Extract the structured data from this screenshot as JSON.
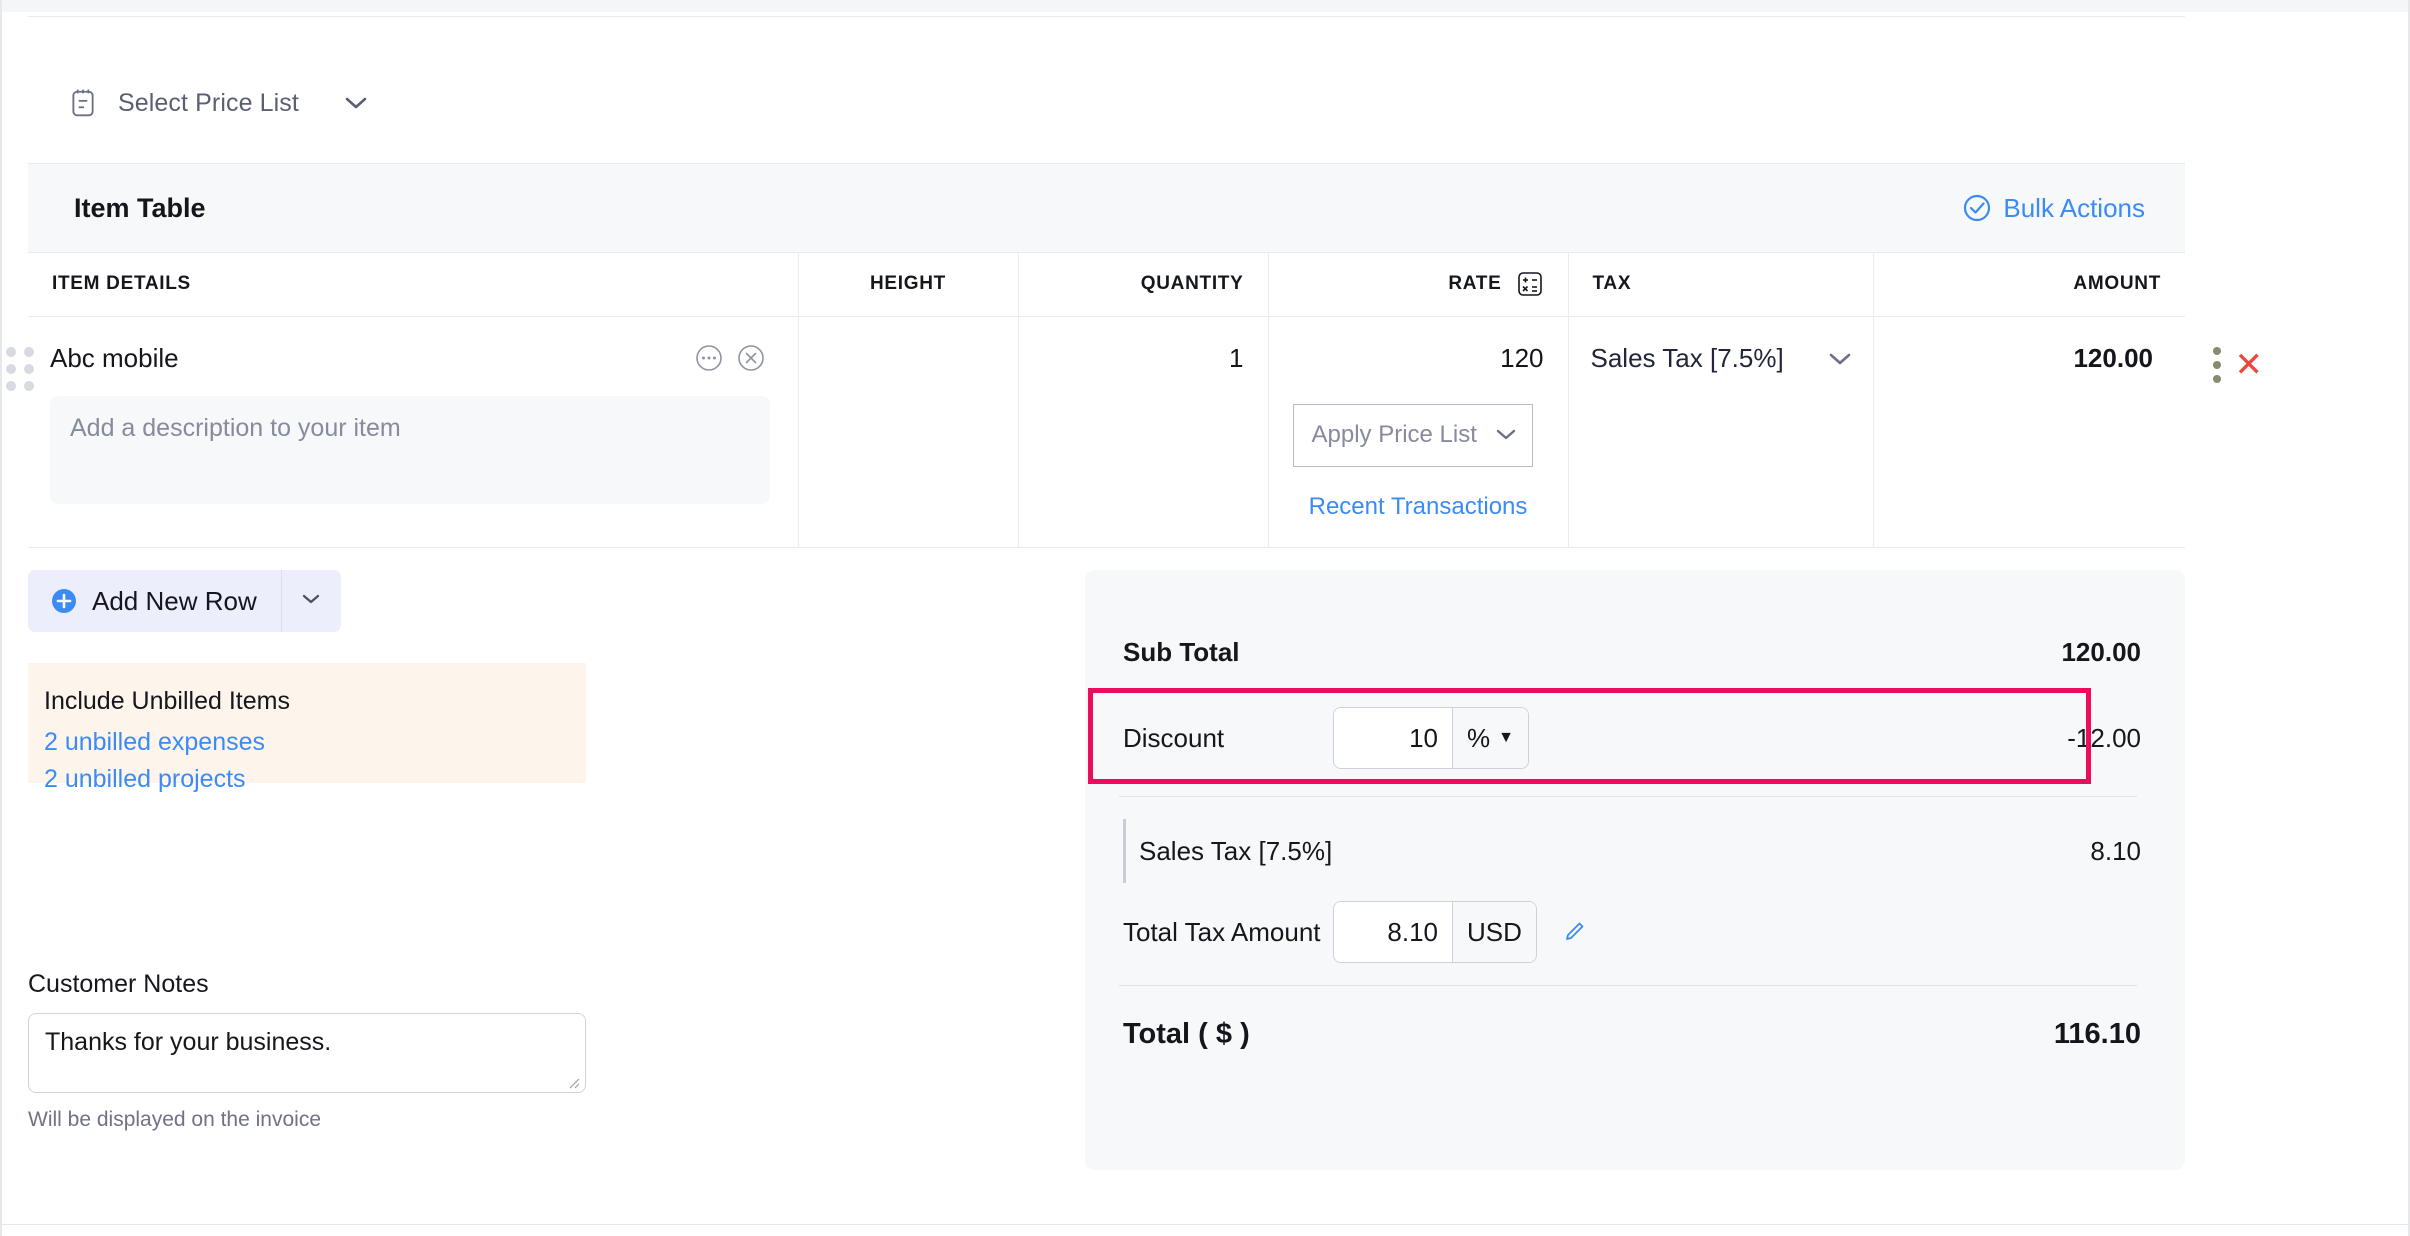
{
  "price_list": {
    "label": "Select Price List",
    "icon": "clipboard-icon"
  },
  "item_table": {
    "title": "Item Table",
    "bulk_actions_label": "Bulk Actions",
    "columns": {
      "item_details": "ITEM DETAILS",
      "height": "HEIGHT",
      "quantity": "QUANTITY",
      "rate": "RATE",
      "tax": "TAX",
      "amount": "AMOUNT"
    },
    "row": {
      "name": "Abc mobile",
      "description_placeholder": "Add a description to your item",
      "height": "",
      "quantity": "1",
      "rate": "120",
      "apply_price_list": "Apply Price List",
      "recent_transactions": "Recent Transactions",
      "tax": "Sales Tax [7.5%]",
      "amount": "120.00"
    }
  },
  "add_new_row": {
    "label": "Add New Row"
  },
  "unbilled": {
    "title": "Include Unbilled Items",
    "links": [
      "2 unbilled expenses",
      "2 unbilled projects"
    ]
  },
  "customer_notes": {
    "label": "Customer Notes",
    "value": "Thanks for your business.",
    "hint": "Will be displayed on the invoice"
  },
  "totals": {
    "sub_total_label": "Sub Total",
    "sub_total_value": "120.00",
    "discount_label": "Discount",
    "discount_input": "10",
    "discount_unit": "%",
    "discount_value": "-12.00",
    "sales_tax_label": "Sales Tax [7.5%]",
    "sales_tax_value": "8.10",
    "total_tax_label": "Total Tax Amount",
    "total_tax_input": "8.10",
    "total_tax_currency": "USD",
    "grand_total_label": "Total ( $ )",
    "grand_total_value": "116.10"
  },
  "colors": {
    "accent_blue": "#3b8bf5",
    "highlight_pink": "#ec0b5c",
    "delete_red": "#f0453a",
    "panel_bg": "#f7f8fa",
    "unbilled_bg": "#fdf4ec"
  }
}
